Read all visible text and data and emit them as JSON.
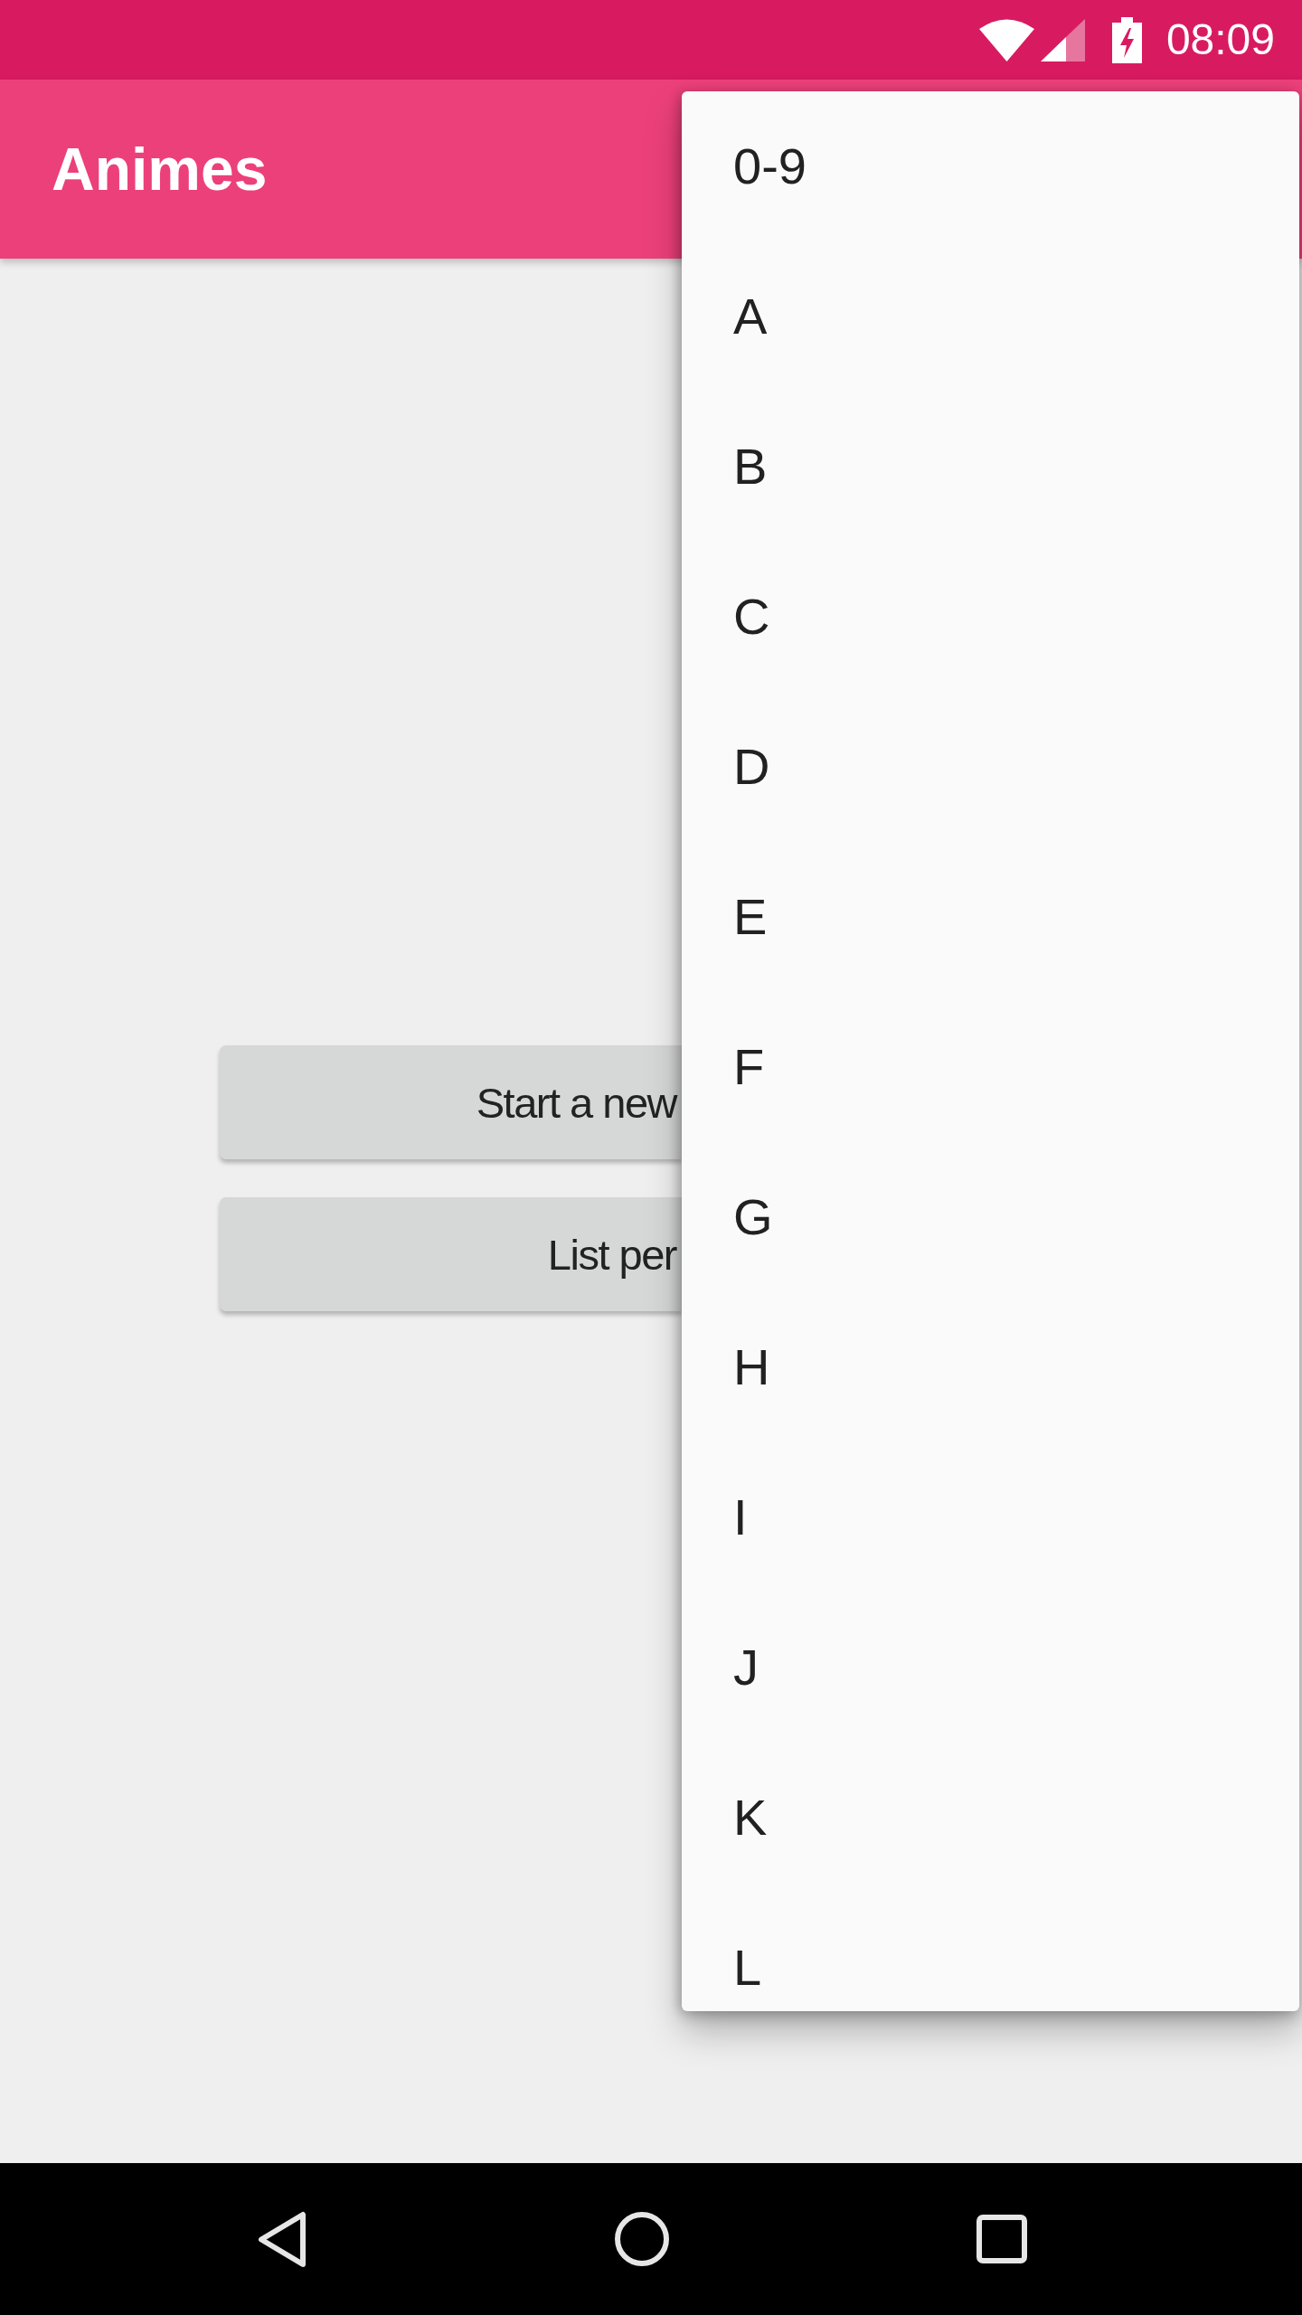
{
  "status_bar": {
    "time": "08:09"
  },
  "app_bar": {
    "title": "Animes"
  },
  "buttons": [
    {
      "label": "Start a new"
    },
    {
      "label": "List per"
    }
  ],
  "menu": {
    "items": [
      {
        "label": "0-9"
      },
      {
        "label": "A"
      },
      {
        "label": "B"
      },
      {
        "label": "C"
      },
      {
        "label": "D"
      },
      {
        "label": "E"
      },
      {
        "label": "F"
      },
      {
        "label": "G"
      },
      {
        "label": "H"
      },
      {
        "label": "I"
      },
      {
        "label": "J"
      },
      {
        "label": "K"
      },
      {
        "label": "L"
      }
    ]
  }
}
